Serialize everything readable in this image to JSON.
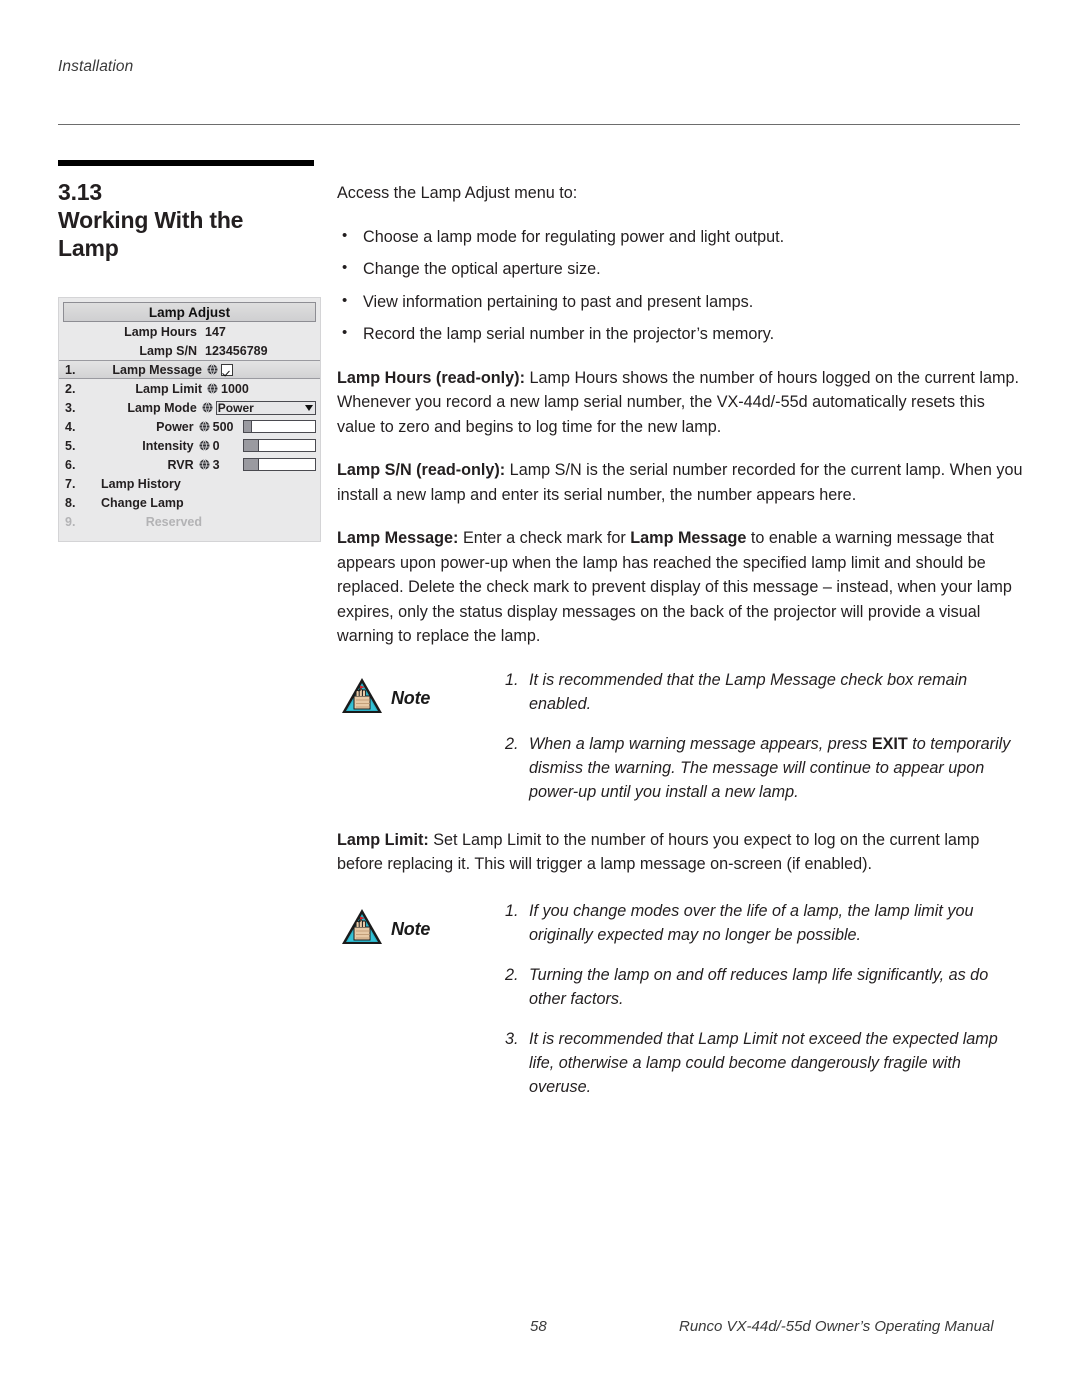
{
  "header": {
    "running_head": "Installation"
  },
  "section": {
    "number": "3.13",
    "title_line1": "Working With the",
    "title_line2": "Lamp"
  },
  "osd": {
    "title": "Lamp Adjust",
    "readonly_rows": [
      {
        "label": "Lamp Hours",
        "value": "147"
      },
      {
        "label": "Lamp S/N",
        "value": "123456789"
      }
    ],
    "rows": [
      {
        "index": "1.",
        "label": "Lamp Message",
        "globe": "globe-icon",
        "control": "checkbox",
        "value": ""
      },
      {
        "index": "2.",
        "label": "Lamp Limit",
        "globe": "globe-icon",
        "control": "value",
        "value": "1000"
      },
      {
        "index": "3.",
        "label": "Lamp Mode",
        "globe": "globe-icon",
        "control": "dropdown",
        "value": "Power"
      },
      {
        "index": "4.",
        "label": "Power",
        "globe": "globe-icon",
        "control": "slider",
        "value": "500",
        "fill_pct": 12
      },
      {
        "index": "5.",
        "label": "Intensity",
        "globe": "globe-icon",
        "control": "slider",
        "value": "0",
        "fill_pct": 22
      },
      {
        "index": "6.",
        "label": "RVR",
        "globe": "globe-icon",
        "control": "slider",
        "value": "3",
        "fill_pct": 22
      },
      {
        "index": "7.",
        "label": "Lamp History",
        "control": "none",
        "value": ""
      },
      {
        "index": "8.",
        "label": "Change Lamp",
        "control": "none",
        "value": ""
      },
      {
        "index": "9.",
        "label": "Reserved",
        "control": "none",
        "value": "",
        "disabled": true
      }
    ]
  },
  "main": {
    "intro": "Access the Lamp Adjust menu to:",
    "bullets": [
      "Choose a lamp mode for regulating power and light output.",
      "Change the optical aperture size.",
      "View information pertaining to past and present lamps.",
      "Record the lamp serial number in the projector’s memory."
    ],
    "para_lamp_hours_label": "Lamp Hours (read-only):",
    "para_lamp_hours_text": " Lamp Hours shows the number of hours logged on the current lamp. Whenever you record a new lamp serial number, the VX-44d/-55d automatically resets this value to zero and begins to log time for the new lamp.",
    "para_lamp_sn_label": "Lamp S/N (read-only):",
    "para_lamp_sn_text": " Lamp S/N is the serial number recorded for the current lamp. When you install a new lamp and enter its serial number, the number appears here.",
    "para_lamp_message_label": "Lamp Message:",
    "para_lamp_message_text1": " Enter a check mark for ",
    "para_lamp_message_bold2": "Lamp Message",
    "para_lamp_message_text2": " to enable a warning message that appears upon power-up when the lamp has reached the specified lamp limit and should be replaced. Delete the check mark to prevent display of this message – instead, when your lamp expires, only the status display messages on the back of the projector will provide a visual warning to replace the lamp.",
    "para_lamp_limit_label": "Lamp Limit:",
    "para_lamp_limit_text": " Set Lamp Limit to the number of hours you expect to log on the current lamp before replacing it. This will trigger a lamp message on-screen (if enabled)."
  },
  "note1": {
    "word": "Note",
    "icon": "note-triangle-hand-icon",
    "items": [
      {
        "num": "1.",
        "text": "It is recommended that the Lamp Message check box remain enabled."
      },
      {
        "num": "2.",
        "pre": "When a lamp warning message appears, press ",
        "bold": "EXIT",
        "post": " to temporarily dismiss the warning. The message will continue to appear upon power-up until you install a new lamp."
      }
    ]
  },
  "note2": {
    "word": "Note",
    "icon": "note-triangle-hand-icon",
    "items": [
      {
        "num": "1.",
        "text": "If you change modes over the life of a lamp, the lamp limit you originally expected may no longer be possible."
      },
      {
        "num": "2.",
        "text": "Turning the lamp on and off reduces lamp life significantly, as do other factors."
      },
      {
        "num": "3.",
        "text": "It is recommended that Lamp Limit not exceed the expected lamp life, otherwise a lamp could become dangerously fragile with overuse."
      }
    ]
  },
  "footer": {
    "page_number": "58",
    "manual_name": "Runco VX-44d/-55d Owner’s Operating Manual"
  },
  "colors": {
    "note_triangle_fill": "#2bb3c8",
    "note_triangle_border": "#1a1a1a",
    "rule": "#000000",
    "osd_bg": "#e9e9ea"
  }
}
